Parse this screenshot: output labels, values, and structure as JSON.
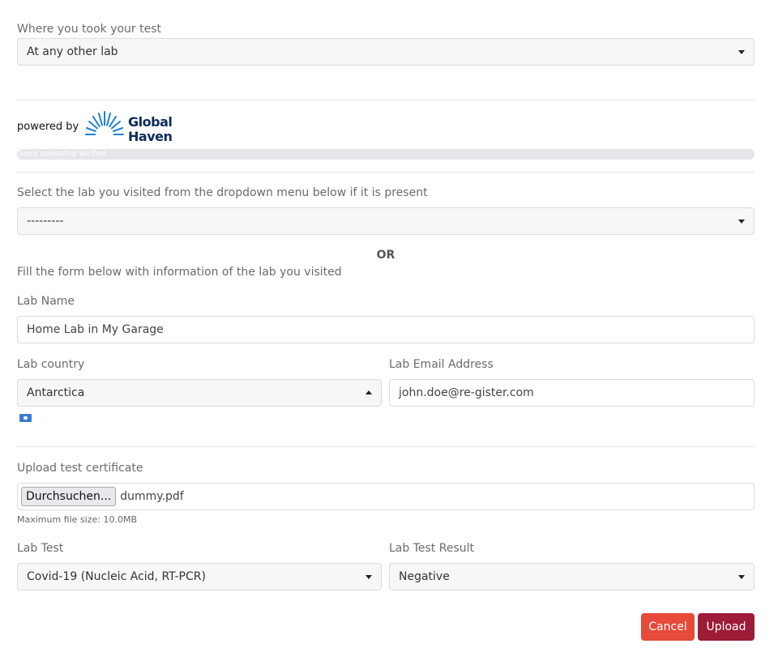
{
  "test_location": {
    "label": "Where you took your test",
    "value": "At any other lab"
  },
  "powered_by": {
    "text": "powered by",
    "logo_line1": "Global",
    "logo_line2": "Haven"
  },
  "progress": {
    "text": "Sorry uploading Verified",
    "fraction": 0
  },
  "lab_select": {
    "label": "Select the lab you visited from the dropdown menu below if it is present",
    "value": "---------"
  },
  "or_text": "OR",
  "form_intro": "Fill the form below with information of the lab you visited",
  "lab_name": {
    "label": "Lab Name",
    "value": "Home Lab in My Garage"
  },
  "lab_country": {
    "label": "Lab country",
    "value": "Antarctica"
  },
  "lab_email": {
    "label": "Lab Email Address",
    "value": "john.doe@re-gister.com"
  },
  "certificate": {
    "label": "Upload test certificate",
    "browse_label": "Durchsuchen...",
    "file_name": "dummy.pdf",
    "max_size_note": "Maximum file size: 10.0MB"
  },
  "lab_test": {
    "label": "Lab Test",
    "value": "Covid-19 (Nucleic Acid, RT-PCR)"
  },
  "lab_test_result": {
    "label": "Lab Test Result",
    "value": "Negative"
  },
  "actions": {
    "cancel_label": "Cancel",
    "upload_label": "Upload"
  },
  "colors": {
    "cancel": "#e54a3a",
    "upload": "#9d1c37",
    "logo": "#0b2b5c"
  }
}
